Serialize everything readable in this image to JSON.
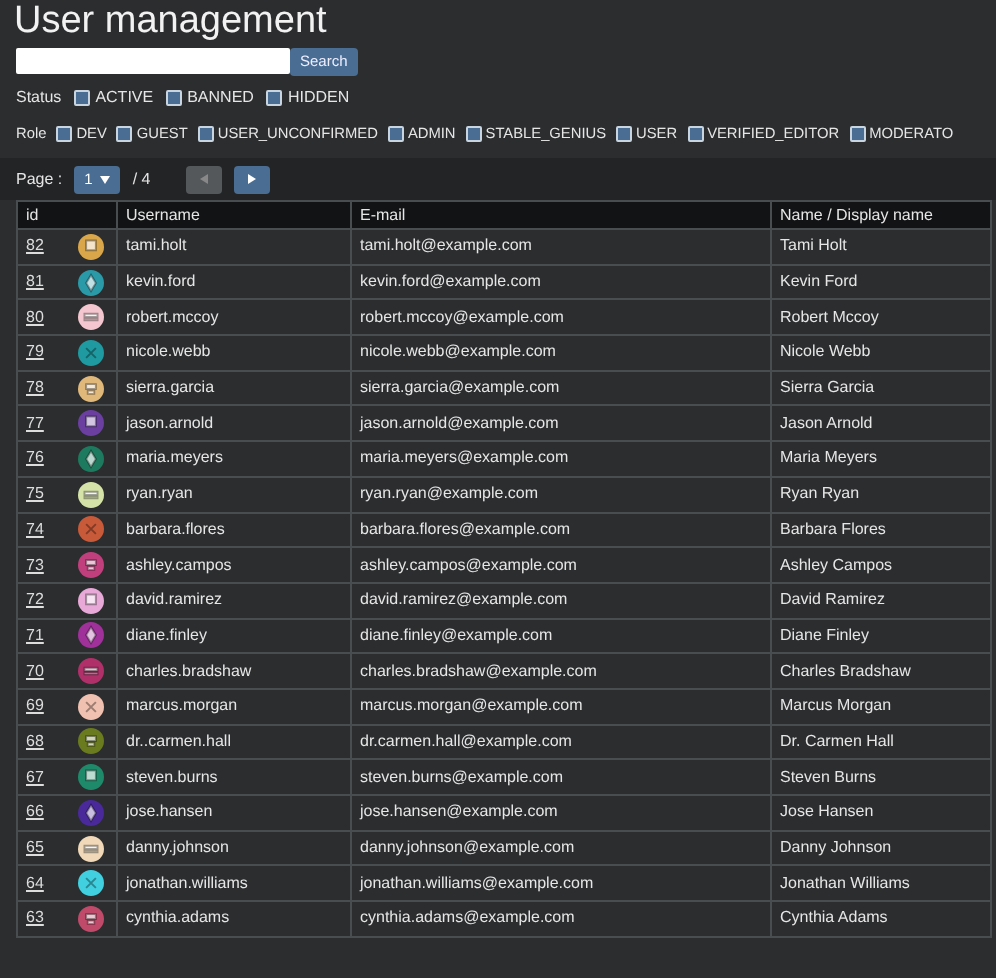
{
  "title": "User management",
  "search": {
    "button": "Search"
  },
  "status": {
    "label": "Status",
    "options": [
      {
        "label": "ACTIVE",
        "checked": false
      },
      {
        "label": "BANNED",
        "checked": false
      },
      {
        "label": "HIDDEN",
        "checked": false
      }
    ]
  },
  "role": {
    "label": "Role",
    "options": [
      {
        "label": "DEV",
        "checked": false
      },
      {
        "label": "GUEST",
        "checked": false
      },
      {
        "label": "USER_UNCONFIRMED",
        "checked": false
      },
      {
        "label": "ADMIN",
        "checked": false
      },
      {
        "label": "STABLE_GENIUS",
        "checked": false
      },
      {
        "label": "USER",
        "checked": false
      },
      {
        "label": "VERIFIED_EDITOR",
        "checked": false
      },
      {
        "label": "MODERATO",
        "checked": false
      }
    ]
  },
  "pager": {
    "label": "Page :",
    "page": "1",
    "total": "/ 4",
    "prev_disabled": true,
    "next_disabled": false
  },
  "table": {
    "columns": [
      "id",
      "Username",
      "E-mail",
      "Name / Display name"
    ],
    "rows": [
      {
        "id": "82",
        "color": "#d9a64a",
        "username": "tami.holt",
        "email": "tami.holt@example.com",
        "name": "Tami Holt"
      },
      {
        "id": "81",
        "color": "#2a9aa8",
        "username": "kevin.ford",
        "email": "kevin.ford@example.com",
        "name": "Kevin Ford"
      },
      {
        "id": "80",
        "color": "#f4c6cf",
        "username": "robert.mccoy",
        "email": "robert.mccoy@example.com",
        "name": "Robert Mccoy"
      },
      {
        "id": "79",
        "color": "#1f9aa0",
        "username": "nicole.webb",
        "email": "nicole.webb@example.com",
        "name": "Nicole Webb"
      },
      {
        "id": "78",
        "color": "#e0b87a",
        "username": "sierra.garcia",
        "email": "sierra.garcia@example.com",
        "name": "Sierra Garcia"
      },
      {
        "id": "77",
        "color": "#6a3fa0",
        "username": "jason.arnold",
        "email": "jason.arnold@example.com",
        "name": "Jason Arnold"
      },
      {
        "id": "76",
        "color": "#1e7a5e",
        "username": "maria.meyers",
        "email": "maria.meyers@example.com",
        "name": "Maria Meyers"
      },
      {
        "id": "75",
        "color": "#d6e3a8",
        "username": "ryan.ryan",
        "email": "ryan.ryan@example.com",
        "name": "Ryan Ryan"
      },
      {
        "id": "74",
        "color": "#c85a3a",
        "username": "barbara.flores",
        "email": "barbara.flores@example.com",
        "name": "Barbara Flores"
      },
      {
        "id": "73",
        "color": "#c23f7e",
        "username": "ashley.campos",
        "email": "ashley.campos@example.com",
        "name": "Ashley Campos"
      },
      {
        "id": "72",
        "color": "#e8a8d8",
        "username": "david.ramirez",
        "email": "david.ramirez@example.com",
        "name": "David Ramirez"
      },
      {
        "id": "71",
        "color": "#a0309a",
        "username": "diane.finley",
        "email": "diane.finley@example.com",
        "name": "Diane Finley"
      },
      {
        "id": "70",
        "color": "#b0306a",
        "username": "charles.bradshaw",
        "email": "charles.bradshaw@example.com",
        "name": "Charles Bradshaw"
      },
      {
        "id": "69",
        "color": "#f0c0b0",
        "username": "marcus.morgan",
        "email": "marcus.morgan@example.com",
        "name": "Marcus Morgan"
      },
      {
        "id": "68",
        "color": "#6a7a1e",
        "username": "dr..carmen.hall",
        "email": "dr.carmen.hall@example.com",
        "name": "Dr. Carmen Hall"
      },
      {
        "id": "67",
        "color": "#1e8a6a",
        "username": "steven.burns",
        "email": "steven.burns@example.com",
        "name": "Steven Burns"
      },
      {
        "id": "66",
        "color": "#4a2a9a",
        "username": "jose.hansen",
        "email": "jose.hansen@example.com",
        "name": "Jose Hansen"
      },
      {
        "id": "65",
        "color": "#f0d8b8",
        "username": "danny.johnson",
        "email": "danny.johnson@example.com",
        "name": "Danny Johnson"
      },
      {
        "id": "64",
        "color": "#40d0e0",
        "username": "jonathan.williams",
        "email": "jonathan.williams@example.com",
        "name": "Jonathan Williams"
      },
      {
        "id": "63",
        "color": "#c04a6a",
        "username": "cynthia.adams",
        "email": "cynthia.adams@example.com",
        "name": "Cynthia Adams"
      }
    ]
  }
}
